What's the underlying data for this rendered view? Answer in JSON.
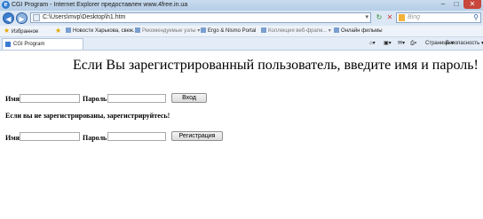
{
  "window": {
    "title": "CGI Program - Internet Explorer предоставлен www.4free.in.ua",
    "minimize": "–",
    "maximize": "□",
    "close": "✕"
  },
  "address_bar": {
    "url": "C:\\Users\\mvp\\Desktop\\h1.htm",
    "search_placeholder": "Bing"
  },
  "favorites_bar": {
    "favorites_label": "Избранное",
    "items": [
      "Новости Харькова, свеж...",
      "Рекомендуемые узлы ▾",
      "Ergo & Nismo Portal",
      "Коллекция веб-фрагм... ▾",
      "Онлайн фильмы"
    ]
  },
  "tab": {
    "label": "CGI Program"
  },
  "command_bar": {
    "page_menu": "Страница ▾",
    "safety_menu": "Безопасность ▾"
  },
  "page": {
    "heading": "Если Вы зарегистрированный пользователь, введите имя и пароль!",
    "login": {
      "name_label": "Имя",
      "password_label": "Пароль",
      "submit_label": "Вход"
    },
    "register_note": "Если вы не зарегистрированы, зарегистрируйтесь!",
    "register": {
      "name_label": "Имя",
      "password_label": "Пароль",
      "submit_label": "Регистрация"
    }
  }
}
